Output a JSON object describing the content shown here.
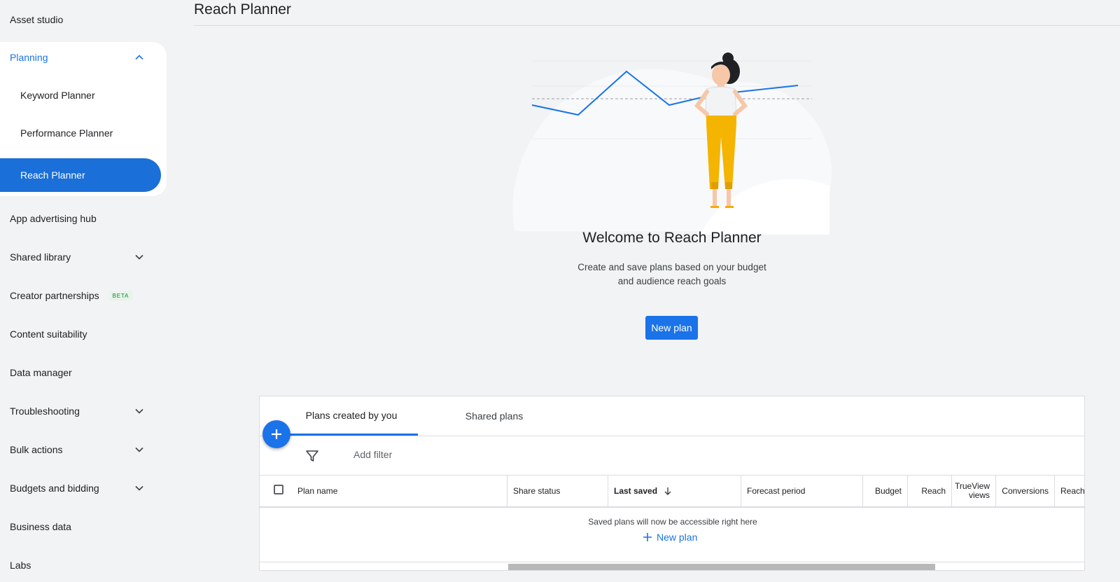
{
  "page": {
    "title": "Reach Planner"
  },
  "sidebar": {
    "asset_studio": "Asset studio",
    "planning": "Planning",
    "keyword_planner": "Keyword Planner",
    "performance_planner": "Performance Planner",
    "reach_planner": "Reach Planner",
    "app_advertising_hub": "App advertising hub",
    "shared_library": "Shared library",
    "creator_partnerships": "Creator partnerships",
    "creator_badge": "BETA",
    "content_suitability": "Content suitability",
    "data_manager": "Data manager",
    "troubleshooting": "Troubleshooting",
    "bulk_actions": "Bulk actions",
    "budgets_and_bidding": "Budgets and bidding",
    "business_data": "Business data",
    "labs": "Labs"
  },
  "welcome": {
    "title": "Welcome to Reach Planner",
    "subtitle_line1": "Create and save plans based on your budget",
    "subtitle_line2": "and audience reach goals",
    "new_plan": "New plan"
  },
  "plans": {
    "tabs": [
      "Plans created by you",
      "Shared plans"
    ],
    "add_filter": "Add filter",
    "columns": {
      "plan_name": "Plan name",
      "share_status": "Share status",
      "last_saved": "Last saved",
      "forecast_period": "Forecast period",
      "budget": "Budget",
      "reach": "Reach",
      "trueview_line1": "TrueView",
      "trueview_line2": "views",
      "conversions": "Conversions",
      "reach_partial": "Reach "
    },
    "empty_message": "Saved plans will now be accessible right here",
    "empty_new_plan": "New plan"
  },
  "colors": {
    "accent": "#1a73e8",
    "selected_nav": "#1a6fd8",
    "figure_pants": "#f4b400",
    "chart_line": "#1a73e8"
  },
  "icons": {
    "planning": "chevron-up-icon",
    "shared_library": "chevron-down-icon",
    "troubleshooting": "chevron-down-icon",
    "bulk_actions": "chevron-down-icon",
    "budgets_and_bidding": "chevron-down-icon",
    "fab": "plus-icon",
    "filter": "filter-icon",
    "sort": "arrow-down-icon",
    "empty_new_plan": "plus-icon"
  }
}
